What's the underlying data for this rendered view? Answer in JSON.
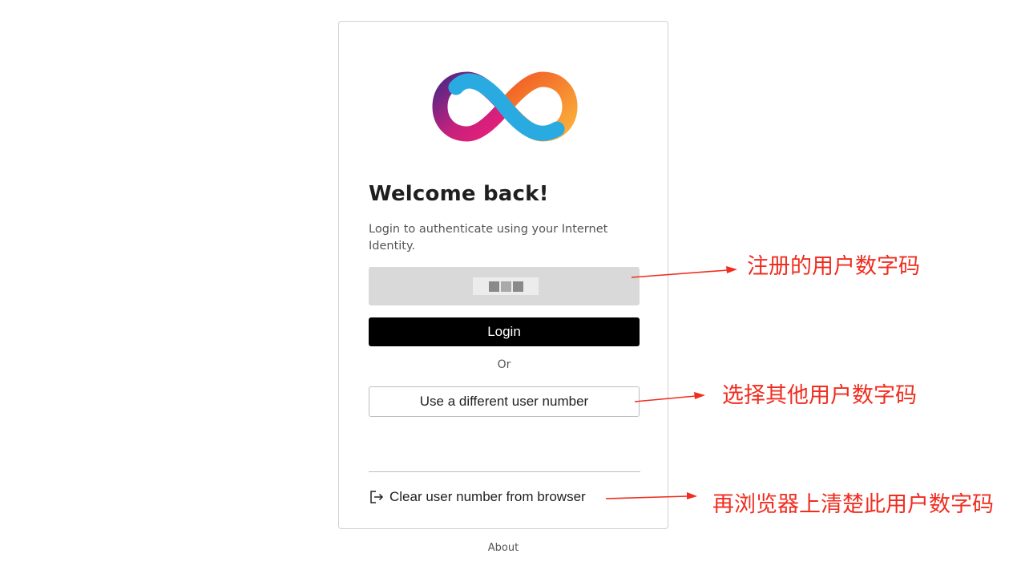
{
  "card": {
    "title": "Welcome back!",
    "subtitle": "Login to authenticate using your Internet Identity.",
    "user_number": "",
    "login_label": "Login",
    "or_label": "Or",
    "different_user_label": "Use a different user number",
    "clear_label": "Clear user number from browser"
  },
  "footer": {
    "about_label": "About"
  },
  "annotations": {
    "registered_number": "注册的用户数字码",
    "choose_other": "选择其他用户数字码",
    "clear_browser": "再浏览器上清楚此用户数字码"
  },
  "colors": {
    "annotation": "#f02d1f",
    "login_button": "#000000",
    "user_number_bg": "#d9d9d9"
  },
  "icons": {
    "logo": "infinity-logo-icon",
    "clear": "logout-icon"
  }
}
